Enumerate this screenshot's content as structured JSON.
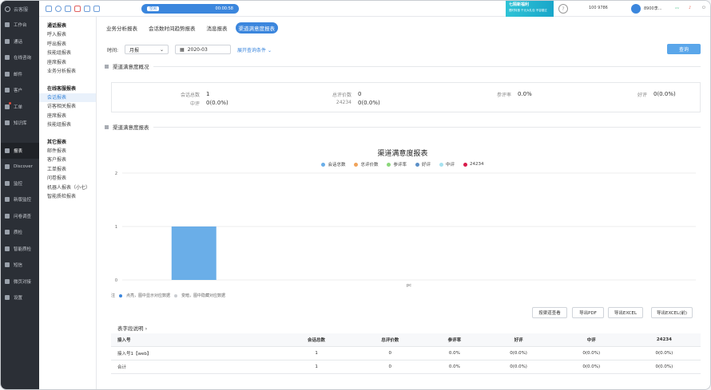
{
  "app": {
    "logo_text": "云客服"
  },
  "sidebar": {
    "items": [
      {
        "label": "工作台",
        "icon": "home-icon"
      },
      {
        "label": "通话",
        "icon": "phone-icon"
      },
      {
        "label": "在线咨询",
        "icon": "chat-icon"
      },
      {
        "label": "邮件",
        "icon": "mail-icon"
      },
      {
        "label": "客户",
        "icon": "user-icon"
      },
      {
        "label": "工单",
        "icon": "ticket-icon"
      },
      {
        "label": "知识库",
        "icon": "book-icon"
      },
      {
        "label": "报表",
        "icon": "chart-icon"
      },
      {
        "label": "Discover",
        "icon": "discover-icon"
      },
      {
        "label": "监控",
        "icon": "monitor-icon"
      },
      {
        "label": "新版监控",
        "icon": "monitor-new-icon"
      },
      {
        "label": "问卷调查",
        "icon": "survey-icon"
      },
      {
        "label": "质检",
        "icon": "qc-icon"
      },
      {
        "label": "智能质检",
        "icon": "smart-qc-icon"
      },
      {
        "label": "短信",
        "icon": "sms-icon"
      },
      {
        "label": "微页对接",
        "icon": "link-icon"
      },
      {
        "label": "设置",
        "icon": "gear-icon"
      }
    ]
  },
  "submenu": {
    "call": {
      "title": "通话报表",
      "items": [
        "呼入报表",
        "呼出报表",
        "技能组报表",
        "座席报表",
        "业务分析报表"
      ]
    },
    "online": {
      "title": "在线客服报表",
      "items": [
        "会话报表",
        "访客相关报表",
        "座席报表",
        "技能组报表"
      ]
    },
    "other": {
      "title": "其它报表",
      "items": [
        "邮件报表",
        "客户报表",
        "工单报表",
        "问卷报表",
        "机器人报表（小七）",
        "智能质检报表"
      ]
    }
  },
  "topbar": {
    "status": "空闲",
    "timer": "00:00:58",
    "banner_title": "七陌新福利",
    "banner_sub": "限时特惠 千元大礼包 不容错过",
    "account": "100      9786",
    "user": "8900李..."
  },
  "tabs": [
    "业务分析报表",
    "会话数时间趋势报表",
    "消息报表",
    "渠道满意度报表"
  ],
  "filters": {
    "time_label": "时间:",
    "period": "月报",
    "date": "2020-03",
    "expand": "展开查询条件",
    "query_button": "查询"
  },
  "sections": {
    "overview": "渠道满意度概况",
    "report": "渠道满意度报表"
  },
  "summary": [
    {
      "k": "会话总数",
      "v": "1"
    },
    {
      "k": "总评价数",
      "v": "0"
    },
    {
      "k": "参评率",
      "v": "0.0%"
    },
    {
      "k": "好评",
      "v": "0(0.0%)"
    },
    {
      "k": "中评",
      "v": "0(0.0%)"
    },
    {
      "k": "24234",
      "v": "0(0.0%)"
    }
  ],
  "chart_data": {
    "type": "bar",
    "title": "渠道满意度报表",
    "categories": [
      "pc"
    ],
    "series": [
      {
        "name": "会话总数",
        "values": [
          1
        ],
        "color": "#6aaee8"
      },
      {
        "name": "总评价数",
        "values": [
          0
        ],
        "color": "#f0a35a"
      },
      {
        "name": "参评率",
        "values": [
          0
        ],
        "color": "#8bd77a"
      },
      {
        "name": "好评",
        "values": [
          0
        ],
        "color": "#5b8fc7"
      },
      {
        "name": "中评",
        "values": [
          0
        ],
        "color": "#a6e2f0"
      },
      {
        "name": "24234",
        "values": [
          0
        ],
        "color": "#d81b4a"
      }
    ],
    "ylim": [
      0,
      2
    ],
    "yticks": [
      "0",
      "1",
      "2"
    ]
  },
  "note": {
    "prefix": "注",
    "a": "点亮，图中显示对应数据",
    "b": "变暗，图中隐藏对应数据"
  },
  "buttons": [
    "按渠道查看",
    "导出PDF",
    "导出EXCEL",
    "导出EXCEL(前)"
  ],
  "field_desc": "表字段说明",
  "table": {
    "headers": [
      "接入号",
      "会话总数",
      "总评价数",
      "参评率",
      "好评",
      "中评",
      "24234"
    ],
    "rows": [
      [
        "接入号1【web】",
        "1",
        "0",
        "0.0%",
        "0(0.0%)",
        "0(0.0%)",
        "0(0.0%)"
      ],
      [
        "合计",
        "1",
        "0",
        "0.0%",
        "0(0.0%)",
        "0(0.0%)",
        "0(0.0%)"
      ]
    ]
  }
}
